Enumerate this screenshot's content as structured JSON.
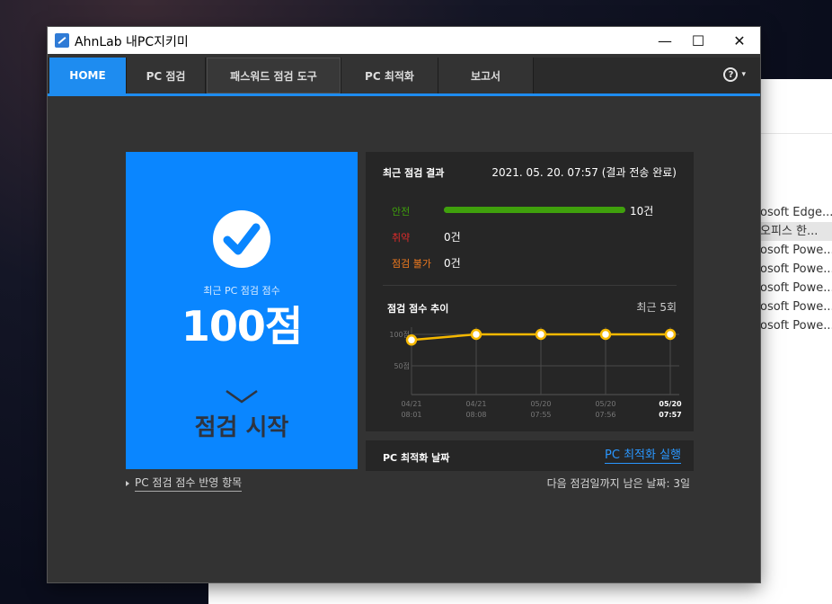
{
  "background": {
    "list_items": [
      "osoft Edge...",
      "오피스 한...",
      "osoft Powe...",
      "osoft Powe...",
      "osoft Powe...",
      "osoft Powe...",
      "osoft Powe..."
    ]
  },
  "window": {
    "title": "AhnLab 내PC지키미",
    "minimize_glyph": "—",
    "maximize_glyph": "☐",
    "close_glyph": "✕"
  },
  "nav": {
    "tabs": [
      "HOME",
      "PC 점검",
      "패스워드 점검 도구",
      "PC 최적화",
      "보고서"
    ],
    "active": "HOME",
    "help_glyph": "?",
    "help_caret": "▾"
  },
  "score": {
    "label": "최근 PC 점검 점수",
    "value": "100점",
    "start_button": "점검 시작",
    "link": "PC 점검 점수 반영 항목"
  },
  "results": {
    "title": "최근 점검 결과",
    "date": "2021. 05. 20. 07:57 (결과 전송 완료)",
    "rows": [
      {
        "label": "안전",
        "count": "10건",
        "color": "#3fa00c",
        "fraction": 1.0
      },
      {
        "label": "취약",
        "count": "0건",
        "color": "#e02b2b",
        "fraction": 0
      },
      {
        "label": "점검 불가",
        "count": "0건",
        "color": "#f07a1e",
        "fraction": 0
      }
    ]
  },
  "trend": {
    "title": "점검 점수 추이",
    "recent": "최근 5회"
  },
  "chart_data": {
    "type": "line",
    "title": "점검 점수 추이",
    "y_tick_labels": [
      "100점",
      "50점"
    ],
    "ylim": [
      0,
      100
    ],
    "categories": [
      {
        "date": "04/21",
        "time": "08:01"
      },
      {
        "date": "04/21",
        "time": "08:08"
      },
      {
        "date": "05/20",
        "time": "07:55"
      },
      {
        "date": "05/20",
        "time": "07:56"
      },
      {
        "date": "05/20",
        "time": "07:57"
      }
    ],
    "values": [
      91,
      100,
      100,
      100,
      100
    ],
    "line_color": "#f5b800",
    "grid": true
  },
  "optimize": {
    "label": "PC 최적화 날짜",
    "link": "PC 최적화 실행",
    "next_check": "다음 점검일까지 남은 날짜: 3일"
  }
}
